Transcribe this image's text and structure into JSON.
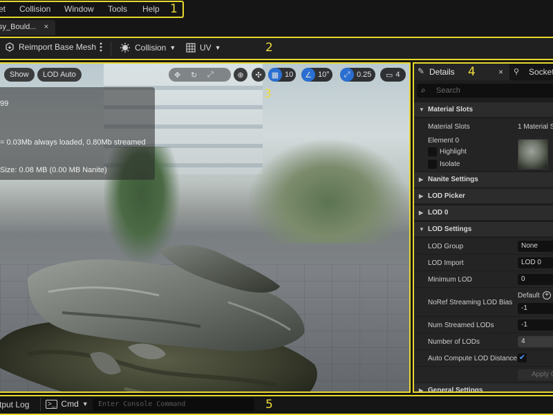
{
  "menubar": {
    "items": [
      "et",
      "Collision",
      "Window",
      "Tools",
      "Help"
    ],
    "zone": "1"
  },
  "tab": {
    "label": "sy_Bould...",
    "close": "×"
  },
  "toolbar": {
    "reimport_label": "Reimport Base Mesh",
    "collision_label": "Collision",
    "uv_label": "UV",
    "zone": "2"
  },
  "viewport": {
    "show_label": "Show",
    "lod_label": "LOD Auto",
    "grid_value": "10",
    "angle_value": "10°",
    "scale_value": "0.25",
    "camera_value": "4",
    "zone": "3",
    "stats": {
      "line1": "99",
      "line2": "= 0.03Mb always loaded, 0.80Mb streamed",
      "line3": "Size: 0.08 MB (0.00 MB Nanite)"
    }
  },
  "details": {
    "tab_label": "Details",
    "tab_close": "×",
    "socket_label": "Socket",
    "zone": "4",
    "search_placeholder": "Search",
    "material_slots": {
      "header": "Material Slots",
      "label": "Material Slots",
      "value": "1 Material Sl",
      "element": "Element 0",
      "highlight": "Highlight",
      "isolate": "Isolate"
    },
    "sections": {
      "nanite": "Nanite Settings",
      "lod_picker": "LOD Picker",
      "lod0": "LOD 0",
      "lod_settings": "LOD Settings",
      "general": "General Settings"
    },
    "lod": {
      "group_label": "LOD Group",
      "group_value": "None",
      "import_label": "LOD Import",
      "import_value": "LOD 0",
      "min_label": "Minimum LOD",
      "min_value": "0",
      "noref_label": "NoRef Streaming LOD Bias",
      "noref_default": "Default",
      "noref_value": "-1",
      "streamed_label": "Num Streamed LODs",
      "streamed_value": "-1",
      "num_label": "Number of LODs",
      "num_value": "4",
      "auto_label": "Auto Compute LOD Distance",
      "apply_label": "Apply C"
    }
  },
  "bottombar": {
    "output_label": "tput Log",
    "cmd_label": "Cmd",
    "console_placeholder": "Enter Console Command",
    "zone": "5"
  }
}
